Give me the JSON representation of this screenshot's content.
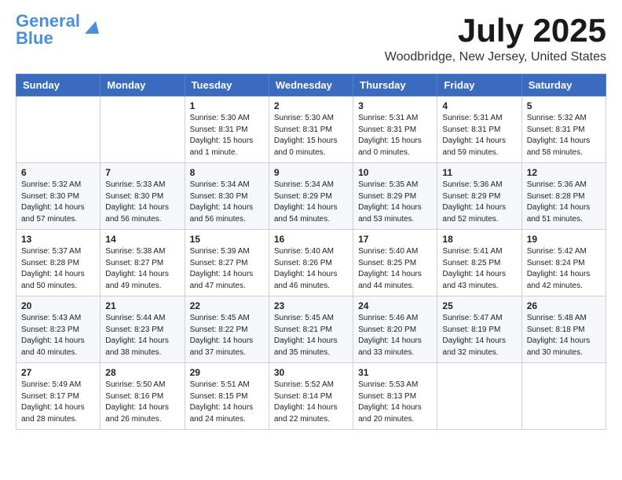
{
  "header": {
    "logo_line1": "General",
    "logo_line2": "Blue",
    "month_title": "July 2025",
    "location": "Woodbridge, New Jersey, United States"
  },
  "weekdays": [
    "Sunday",
    "Monday",
    "Tuesday",
    "Wednesday",
    "Thursday",
    "Friday",
    "Saturday"
  ],
  "weeks": [
    [
      {
        "day": "",
        "info": ""
      },
      {
        "day": "",
        "info": ""
      },
      {
        "day": "1",
        "info": "Sunrise: 5:30 AM\nSunset: 8:31 PM\nDaylight: 15 hours\nand 1 minute."
      },
      {
        "day": "2",
        "info": "Sunrise: 5:30 AM\nSunset: 8:31 PM\nDaylight: 15 hours\nand 0 minutes."
      },
      {
        "day": "3",
        "info": "Sunrise: 5:31 AM\nSunset: 8:31 PM\nDaylight: 15 hours\nand 0 minutes."
      },
      {
        "day": "4",
        "info": "Sunrise: 5:31 AM\nSunset: 8:31 PM\nDaylight: 14 hours\nand 59 minutes."
      },
      {
        "day": "5",
        "info": "Sunrise: 5:32 AM\nSunset: 8:31 PM\nDaylight: 14 hours\nand 58 minutes."
      }
    ],
    [
      {
        "day": "6",
        "info": "Sunrise: 5:32 AM\nSunset: 8:30 PM\nDaylight: 14 hours\nand 57 minutes."
      },
      {
        "day": "7",
        "info": "Sunrise: 5:33 AM\nSunset: 8:30 PM\nDaylight: 14 hours\nand 56 minutes."
      },
      {
        "day": "8",
        "info": "Sunrise: 5:34 AM\nSunset: 8:30 PM\nDaylight: 14 hours\nand 56 minutes."
      },
      {
        "day": "9",
        "info": "Sunrise: 5:34 AM\nSunset: 8:29 PM\nDaylight: 14 hours\nand 54 minutes."
      },
      {
        "day": "10",
        "info": "Sunrise: 5:35 AM\nSunset: 8:29 PM\nDaylight: 14 hours\nand 53 minutes."
      },
      {
        "day": "11",
        "info": "Sunrise: 5:36 AM\nSunset: 8:29 PM\nDaylight: 14 hours\nand 52 minutes."
      },
      {
        "day": "12",
        "info": "Sunrise: 5:36 AM\nSunset: 8:28 PM\nDaylight: 14 hours\nand 51 minutes."
      }
    ],
    [
      {
        "day": "13",
        "info": "Sunrise: 5:37 AM\nSunset: 8:28 PM\nDaylight: 14 hours\nand 50 minutes."
      },
      {
        "day": "14",
        "info": "Sunrise: 5:38 AM\nSunset: 8:27 PM\nDaylight: 14 hours\nand 49 minutes."
      },
      {
        "day": "15",
        "info": "Sunrise: 5:39 AM\nSunset: 8:27 PM\nDaylight: 14 hours\nand 47 minutes."
      },
      {
        "day": "16",
        "info": "Sunrise: 5:40 AM\nSunset: 8:26 PM\nDaylight: 14 hours\nand 46 minutes."
      },
      {
        "day": "17",
        "info": "Sunrise: 5:40 AM\nSunset: 8:25 PM\nDaylight: 14 hours\nand 44 minutes."
      },
      {
        "day": "18",
        "info": "Sunrise: 5:41 AM\nSunset: 8:25 PM\nDaylight: 14 hours\nand 43 minutes."
      },
      {
        "day": "19",
        "info": "Sunrise: 5:42 AM\nSunset: 8:24 PM\nDaylight: 14 hours\nand 42 minutes."
      }
    ],
    [
      {
        "day": "20",
        "info": "Sunrise: 5:43 AM\nSunset: 8:23 PM\nDaylight: 14 hours\nand 40 minutes."
      },
      {
        "day": "21",
        "info": "Sunrise: 5:44 AM\nSunset: 8:23 PM\nDaylight: 14 hours\nand 38 minutes."
      },
      {
        "day": "22",
        "info": "Sunrise: 5:45 AM\nSunset: 8:22 PM\nDaylight: 14 hours\nand 37 minutes."
      },
      {
        "day": "23",
        "info": "Sunrise: 5:45 AM\nSunset: 8:21 PM\nDaylight: 14 hours\nand 35 minutes."
      },
      {
        "day": "24",
        "info": "Sunrise: 5:46 AM\nSunset: 8:20 PM\nDaylight: 14 hours\nand 33 minutes."
      },
      {
        "day": "25",
        "info": "Sunrise: 5:47 AM\nSunset: 8:19 PM\nDaylight: 14 hours\nand 32 minutes."
      },
      {
        "day": "26",
        "info": "Sunrise: 5:48 AM\nSunset: 8:18 PM\nDaylight: 14 hours\nand 30 minutes."
      }
    ],
    [
      {
        "day": "27",
        "info": "Sunrise: 5:49 AM\nSunset: 8:17 PM\nDaylight: 14 hours\nand 28 minutes."
      },
      {
        "day": "28",
        "info": "Sunrise: 5:50 AM\nSunset: 8:16 PM\nDaylight: 14 hours\nand 26 minutes."
      },
      {
        "day": "29",
        "info": "Sunrise: 5:51 AM\nSunset: 8:15 PM\nDaylight: 14 hours\nand 24 minutes."
      },
      {
        "day": "30",
        "info": "Sunrise: 5:52 AM\nSunset: 8:14 PM\nDaylight: 14 hours\nand 22 minutes."
      },
      {
        "day": "31",
        "info": "Sunrise: 5:53 AM\nSunset: 8:13 PM\nDaylight: 14 hours\nand 20 minutes."
      },
      {
        "day": "",
        "info": ""
      },
      {
        "day": "",
        "info": ""
      }
    ]
  ]
}
